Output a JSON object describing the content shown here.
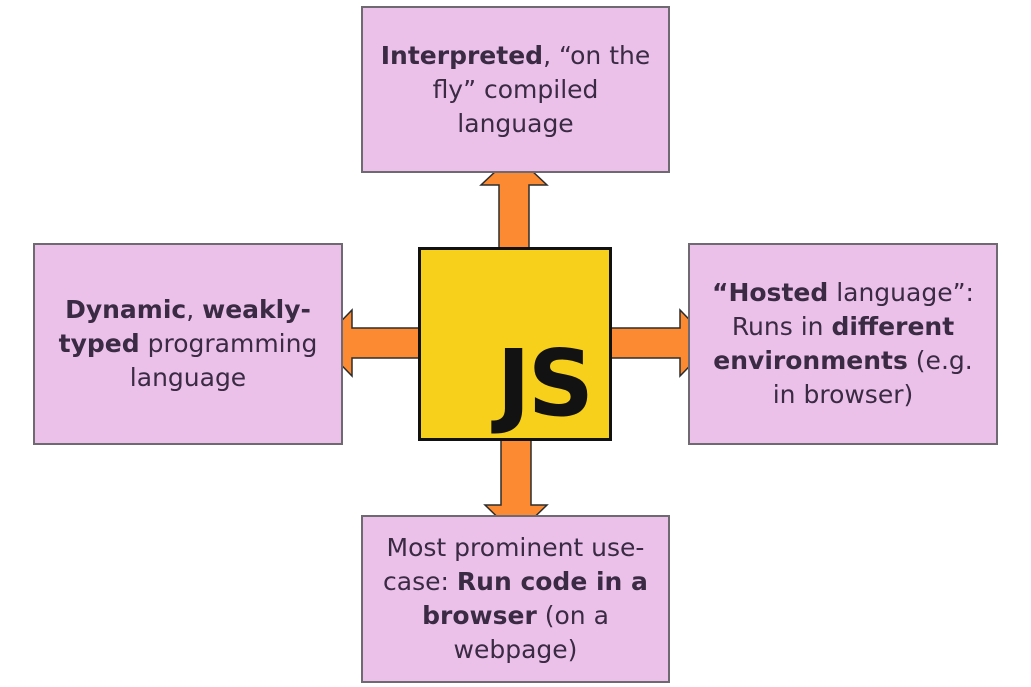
{
  "colors": {
    "box_fill": "#ebc1ea",
    "box_border": "#6f6a72",
    "logo_fill": "#f7d01c",
    "arrow_fill": "#fb8a33",
    "arrow_stroke": "#2d2d2d",
    "text": "#3a2a44"
  },
  "logo": {
    "text": "JS"
  },
  "boxes": {
    "top": [
      {
        "text": "Interpreted",
        "bold": true
      },
      {
        "text": ", “on the fly” compiled language",
        "bold": false
      }
    ],
    "left": [
      {
        "text": "Dynamic",
        "bold": true
      },
      {
        "text": ", ",
        "bold": false
      },
      {
        "text": "weakly-typed",
        "bold": true
      },
      {
        "text": " programming language",
        "bold": false
      }
    ],
    "right": [
      {
        "text": "“Hosted",
        "bold": true
      },
      {
        "text": " language”: Runs in ",
        "bold": false
      },
      {
        "text": "different environments",
        "bold": true
      },
      {
        "text": " (e.g. in browser)",
        "bold": false
      }
    ],
    "bottom": [
      {
        "text": "Most prominent use-case: ",
        "bold": false
      },
      {
        "text": "Run code in a browser",
        "bold": true
      },
      {
        "text": " (on a webpage)",
        "bold": false
      }
    ]
  }
}
